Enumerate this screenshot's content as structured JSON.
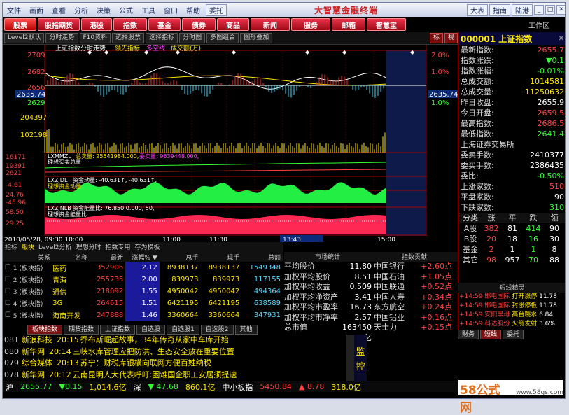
{
  "menu": {
    "items": [
      "文件",
      "画面",
      "查看",
      "分析",
      "决策",
      "公式",
      "工具",
      "窗口",
      "帮助"
    ],
    "right_btn": "委托",
    "title": "大智慧金融终端",
    "right_tabs": [
      "大表",
      "指南",
      "陆港"
    ]
  },
  "toolbar": {
    "items": [
      "股票",
      "股指期货",
      "港股",
      "指数",
      "基金",
      "债券",
      "商品",
      "新闻",
      "服务",
      "邮箱",
      "智慧宝"
    ],
    "right_label": "工作区"
  },
  "subbar": {
    "items": [
      "Level2默认",
      "分时走势",
      "F10资料",
      "选择股票",
      "选择指标",
      "分时图",
      "多图组合",
      "图形叠加"
    ],
    "flag": "标",
    "view": "视"
  },
  "chart": {
    "title_left": "上证指数分时走势",
    "title_ind1": "领先指标",
    "title_ind2": "多空线",
    "title_ind3": "成交额(万)",
    "left_prices": [
      "2709",
      "2682",
      "2656",
      "2629"
    ],
    "current_price": "2635.74",
    "right_pcts": [
      "2.0%",
      "1.0%",
      "1.0%"
    ],
    "vol_labels": [
      "204397",
      "102198"
    ],
    "ind2_name": "LXMMZL",
    "ind2_total": "总卖量: 25541984.000,",
    "ind2_sell": "委卖量: 9639448.000,",
    "ind2_label": "理想买卖总量",
    "ind2_left": [
      "16171",
      "19391",
      "2621"
    ],
    "ind3_name": "LXZJDL",
    "ind3_text": "资金动量: -40.631↑, -40.631↑,",
    "ind3_label": "理想资金动量",
    "ind3_left": [
      "-4.61",
      "24.76",
      "-45.96"
    ],
    "ind4_name": "LXZJNLB",
    "ind4_text": "资金能量比: 76.850 0.000, 50,",
    "ind4_label": "理想资金能量比",
    "ind4_left": [
      "58.50",
      "29.25"
    ],
    "xaxis": [
      "2010/05/28, 09:30 10:00",
      "11:00",
      "11:30",
      "13:43",
      "15:00"
    ]
  },
  "right": {
    "code": "000001",
    "name": "上证指数",
    "rows": [
      {
        "k": "最新指数:",
        "v": "2655.7",
        "c": "red"
      },
      {
        "k": "指数涨跌:",
        "v": "▼0.1",
        "c": "green"
      },
      {
        "k": "指数涨幅:",
        "v": "-0.01%",
        "c": "green"
      },
      {
        "k": "总成交额:",
        "v": "1014581",
        "c": "yellow"
      },
      {
        "k": "总成交量:",
        "v": "11250632",
        "c": "yellow"
      },
      {
        "k": "昨日收盘:",
        "v": "2655.9",
        "c": "white"
      },
      {
        "k": "今日开盘:",
        "v": "2659.5",
        "c": "red"
      },
      {
        "k": "最高指数:",
        "v": "2686.5",
        "c": "red"
      },
      {
        "k": "最低指数:",
        "v": "2641.4",
        "c": "green"
      }
    ],
    "exchange": "上海证券交易所",
    "rows2": [
      {
        "k": "委卖手数:",
        "v": "2410377",
        "c": "white"
      },
      {
        "k": "委买手数:",
        "v": "2386435",
        "c": "white"
      },
      {
        "k": "委比:",
        "v": "-0.50%",
        "c": "green"
      },
      {
        "k": "上涨家数:",
        "v": "510",
        "c": "red"
      },
      {
        "k": "平盘家数:",
        "v": "90",
        "c": "white"
      },
      {
        "k": "下跌家数:",
        "v": "310",
        "c": "green"
      }
    ],
    "cat_head": [
      "分类",
      "涨",
      "平",
      "跌",
      "领"
    ],
    "cats": [
      {
        "n": "A股",
        "u": "382",
        "f": "81",
        "d": "414",
        "l": "90"
      },
      {
        "n": "B股",
        "u": "20",
        "f": "18",
        "d": "16",
        "l": "30"
      },
      {
        "n": "基金",
        "u": "2",
        "f": "1",
        "d": "1",
        "l": "8"
      },
      {
        "n": "其它",
        "u": "98",
        "f": "957",
        "d": "70",
        "l": "88"
      }
    ],
    "elf_title": "短线精灵",
    "elf": [
      {
        "t": "14:59",
        "n": "邯电国际",
        "e": "打开涨停",
        "v": "11.78"
      },
      {
        "t": "14:59",
        "n": "邯电国际",
        "e": "封涨停板",
        "v": "11.78"
      },
      {
        "t": "14:59",
        "n": "安阳黑母",
        "e": "高台跳水",
        "v": "6.84"
      },
      {
        "t": "14:59",
        "n": "科达股份",
        "e": "火箭发射",
        "v": "3.6%"
      }
    ],
    "bot_tabs": [
      "财务",
      "短线",
      "委托"
    ]
  },
  "table": {
    "tabs": [
      "指标",
      "版块",
      "Level2分析",
      "理想分时",
      "指数专用",
      "存为模板"
    ],
    "head": [
      "",
      "关系",
      "名称",
      "最新",
      "涨幅%",
      "总手",
      "现手",
      "总额"
    ],
    "rows": [
      {
        "idx": "1",
        "grp": "(板块指)",
        "name": "医药",
        "last": "352906",
        "pct": "2.12",
        "vol": "8938137",
        "cur": "8938137",
        "amt": "1549348"
      },
      {
        "idx": "2",
        "grp": "(板块指)",
        "name": "青海",
        "last": "255735",
        "pct": "2.00",
        "vol": "839973",
        "cur": "839973",
        "amt": "117155"
      },
      {
        "idx": "3",
        "grp": "(板块指)",
        "name": "通信",
        "last": "218092",
        "pct": "1.55",
        "vol": "4950042",
        "cur": "4950042",
        "amt": "494364"
      },
      {
        "idx": "4",
        "grp": "(板块指)",
        "name": "3G",
        "last": "264615",
        "pct": "1.51",
        "vol": "6421195",
        "cur": "6421195",
        "amt": "638589"
      },
      {
        "idx": "5",
        "grp": "(板块指)",
        "name": "海南开发",
        "last": "247888",
        "pct": "1.46",
        "vol": "3360664",
        "cur": "3360664",
        "amt": "347931"
      }
    ],
    "sort_icon": "sort-down-icon"
  },
  "stats": {
    "head": [
      "市场统计",
      "指数贡献"
    ],
    "rows": [
      {
        "a": "平均股价",
        "b": "11.80",
        "c": "中国银行",
        "d": "+2.60点"
      },
      {
        "a": "加权平均股价",
        "b": "8.51",
        "c": "中国石油",
        "d": "+1.05点"
      },
      {
        "a": "加权平均收益",
        "b": "0.509",
        "c": "中国联通",
        "d": "+0.52点"
      },
      {
        "a": "加权平均净资产",
        "b": "3.41",
        "c": "中国人寿",
        "d": "+0.34点"
      },
      {
        "a": "加权平均市盈率",
        "b": "16.73",
        "c": "东方航空",
        "d": "+0.24点"
      },
      {
        "a": "加权平均市净率",
        "b": "2.57",
        "c": "中国铝业",
        "d": "+0.16点"
      },
      {
        "a": "总市值",
        "b": "163450亿",
        "c": "天士力",
        "d": "+0.15点"
      }
    ]
  },
  "tabs2": [
    "板块指数",
    "期货指数",
    "上证指数",
    "自选股",
    "自选股1",
    "自选股2",
    "其他"
  ],
  "news": [
    {
      "id": "081",
      "src": "新浪科技",
      "tm": "20:15",
      "tx": "乔布斯崛起故事，34年传奇从家中车库开始"
    },
    {
      "id": "080",
      "src": "新华网",
      "tm": "20:14",
      "tx": "三峡水库管理应把防洪、生态安全放在重要位置"
    },
    {
      "id": "079",
      "src": "综合媒体",
      "tm": "20:13",
      "tx": "苏宁：财税库银横向联网方便百姓纳税"
    },
    {
      "id": "078",
      "src": "新华网",
      "tm": "20:12",
      "tx": "云南昆明人大代表呼吁:困难国企职工安居须提速"
    }
  ],
  "jk": [
    "监",
    "控"
  ],
  "ticker": [
    {
      "t": "沪",
      "c": "white"
    },
    {
      "t": "2655.77",
      "c": "green"
    },
    {
      "t": "▼0.15",
      "c": "green"
    },
    {
      "t": "1,014.6亿",
      "c": "yellow"
    },
    {
      "t": "深",
      "c": "white"
    },
    {
      "t": "▼ 47.68",
      "c": "green"
    },
    {
      "t": "860.1亿",
      "c": "yellow"
    },
    {
      "t": "中小板指",
      "c": "white"
    },
    {
      "t": "5450.84",
      "c": "red"
    },
    {
      "t": "▲ 8.78",
      "c": "red"
    },
    {
      "t": "318.0亿",
      "c": "yellow"
    }
  ],
  "watermark": {
    "big": "58公式网",
    "small": "www.58gs.com"
  }
}
